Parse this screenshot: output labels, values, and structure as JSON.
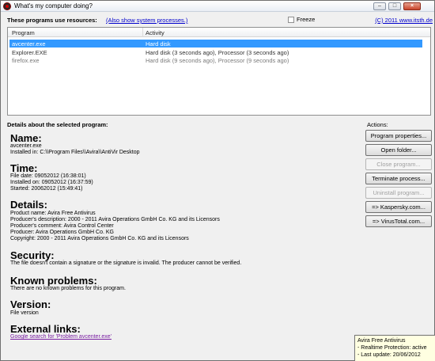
{
  "window": {
    "title": "What's my computer doing?"
  },
  "topbar": {
    "label": "These programs use resources:",
    "show_system_link": "(Also show system processes.)",
    "freeze_label": "Freeze",
    "copyright_link": "(C) 2011 www.itsth.de"
  },
  "list": {
    "columns": [
      "Program",
      "Activity"
    ],
    "rows": [
      {
        "program": "avcenter.exe",
        "activity": "Hard disk"
      },
      {
        "program": "Explorer.EXE",
        "activity": "Hard disk (3 seconds ago), Processor (3 seconds ago)"
      },
      {
        "program": "firefox.exe",
        "activity": "Hard disk (9 seconds ago), Processor (9 seconds ago)"
      }
    ]
  },
  "details": {
    "label": "Details about the selected program:",
    "name_title": "Name:",
    "name_value": "avcenter.exe",
    "installed_in": "Installed in: C:\\\\Program Files\\\\Avira\\\\AntiVir Desktop",
    "time_title": "Time:",
    "file_date": "File date: 09052012 (16:38:01)",
    "installed_on": "Installed on: 09052012 (16:37:59)",
    "started": "Started: 20062012 (15:49:41)",
    "details_title": "Details:",
    "product_name": "Product name: Avira Free Antivirus",
    "producer_desc": "Producer's description: 2000 - 2011 Avira Operations GmbH Co. KG and its Licensors",
    "producer_comment": "Producer's comment: Avira Control Center",
    "producer": "Producer: Avira Operations GmbH Co. KG",
    "copyright": "Copyright: 2000 - 2011 Avira Operations GmbH Co. KG and its Licensors",
    "security_title": "Security:",
    "security_text": "The file doesn't contain a signature or the signature is invalid. The producer cannot be verified.",
    "known_title": "Known problems:",
    "known_text": "There are no known problems for this program.",
    "version_title": "Version:",
    "version_text": "File version",
    "external_title": "External links:",
    "external_link": "Google search for 'Problem avcenter.exe'"
  },
  "actions": {
    "label": "Actions:",
    "program_properties": "Program properties...",
    "open_folder": "Open folder...",
    "close_program": "Close program...",
    "terminate_process": "Terminate process...",
    "uninstall_program": "Uninstall program...",
    "kaspersky": "=> Kaspersky.com...",
    "virustotal": "=> VirusTotal.com..."
  },
  "tooltip": {
    "line1": "Avira Free Antivirus",
    "line2": "- Realtime Protection: active",
    "line3": "- Last update: 20/06/2012"
  },
  "colors": {
    "selection": "#3399ff",
    "link": "#0000cc",
    "visited_link": "#7a1fa2"
  }
}
